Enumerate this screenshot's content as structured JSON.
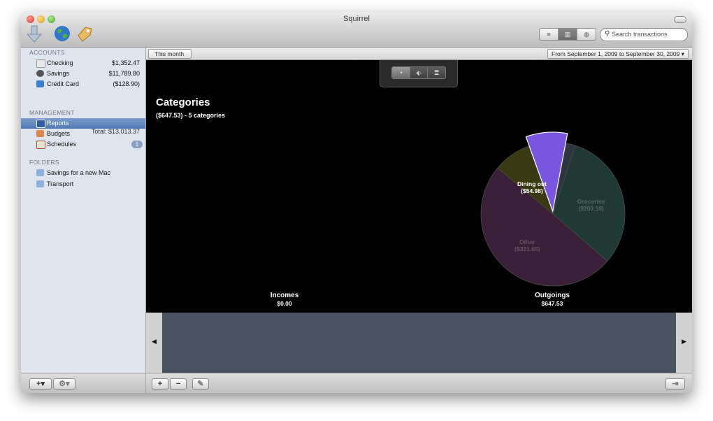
{
  "window": {
    "title": "Squirrel"
  },
  "toolbar": {
    "view_modes": [
      "list-icon",
      "columns-icon",
      "globe-icon"
    ],
    "search": {
      "placeholder": "Search transactions",
      "value": ""
    }
  },
  "sidebar": {
    "accounts_header": "ACCOUNTS",
    "accounts": [
      {
        "name": "Checking",
        "amount": "$1,352.47",
        "icon": "checkbook-icon"
      },
      {
        "name": "Savings",
        "amount": "$11,789.80",
        "icon": "safe-icon"
      },
      {
        "name": "Credit Card",
        "amount": "($128.90)",
        "icon": "credit-card-icon"
      }
    ],
    "total": "Total: $13,013.37",
    "management_header": "MANAGEMENT",
    "management": [
      {
        "name": "Reports",
        "selected": true,
        "icon": "reports-icon"
      },
      {
        "name": "Budgets",
        "icon": "budgets-icon"
      },
      {
        "name": "Schedules",
        "badge": "1",
        "icon": "schedules-icon"
      }
    ],
    "folders_header": "FOLDERS",
    "folders": [
      {
        "name": "Savings for a new Mac",
        "icon": "folder-icon"
      },
      {
        "name": "Transport",
        "icon": "folder-icon"
      }
    ]
  },
  "pathbar": {
    "crumb": "This month",
    "date_range": "From September 1, 2009 to September 30, 2009"
  },
  "report": {
    "title": "Categories",
    "subtitle": "($647.53) - 5 categories",
    "mode_buttons": [
      "pie-chart-icon",
      "tag-icon",
      "list-icon"
    ],
    "incomes_label": "Incomes",
    "incomes_value": "$0.00",
    "outgoings_label": "Outgoings",
    "outgoings_value": "$647.53"
  },
  "chart_data": {
    "type": "pie",
    "title": "",
    "total": 647.53,
    "slices": [
      {
        "label": "Groceries",
        "value_label": "($203.10)",
        "value": 203.1,
        "color": "#1f3a35"
      },
      {
        "label": "Other",
        "value_label": "($321.65)",
        "value": 321.65,
        "color": "#3a1f38"
      },
      {
        "label": "",
        "value_label": "",
        "value": 54.8,
        "color": "#3a3a12"
      },
      {
        "label": "Dining out",
        "value_label": "($54.98)",
        "value": 54.98,
        "color": "#7a55e0",
        "exploded": true,
        "highlighted": true
      },
      {
        "label": "",
        "value_label": "",
        "value": 13.0,
        "color": "#2c3540"
      }
    ]
  },
  "colors": {
    "accent": "#5f82bd",
    "report_bg": "#000000"
  }
}
